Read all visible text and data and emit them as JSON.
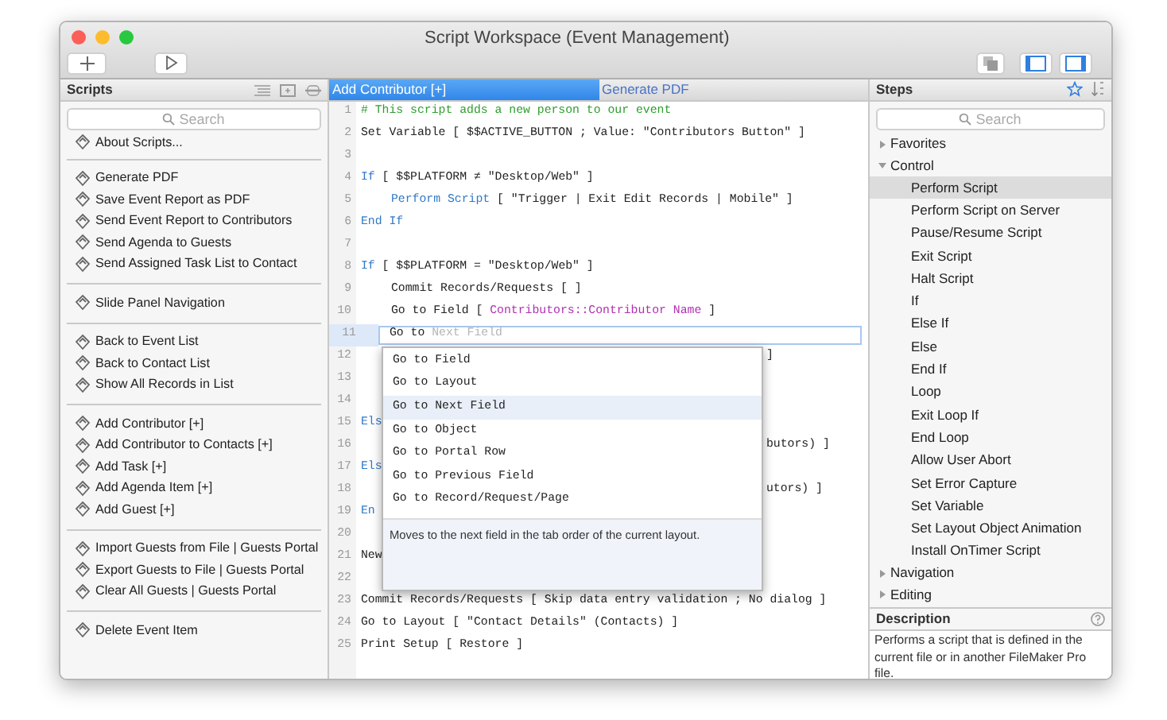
{
  "window": {
    "title": "Script Workspace (Event Management)"
  },
  "toolbar": {
    "toggles": [
      {
        "on": true
      },
      {
        "on": true
      }
    ]
  },
  "scripts": {
    "title": "Scripts",
    "search": {
      "placeholder": "Search"
    },
    "groups": [
      {
        "items": [
          "About Scripts..."
        ]
      },
      {
        "items": [
          "Generate PDF",
          "Save Event Report as PDF",
          "Send Event Report to Contributors",
          "Send Agenda to Guests",
          "Send Assigned Task List to Contact"
        ]
      },
      {
        "items": [
          "Slide Panel Navigation"
        ]
      },
      {
        "items": [
          "Back to Event List",
          "Back to Contact List",
          "Show All Records in List"
        ]
      },
      {
        "items": [
          "Add Contributor [+]",
          "Add Contributor to Contacts [+]",
          "Add Task [+]",
          "Add Agenda Item [+]",
          "Add Guest [+]"
        ]
      },
      {
        "items": [
          "Import Guests from File | Guests Portal",
          "Export Guests to File | Guests Portal",
          "Clear All Guests | Guests Portal"
        ]
      },
      {
        "items": [
          "Delete Event Item"
        ]
      }
    ]
  },
  "editor": {
    "tabs": [
      {
        "label": "Add Contributor [+]",
        "selected": true
      },
      {
        "label": "Generate PDF",
        "selected": false
      }
    ],
    "lines": [
      {
        "number": "1",
        "indented": false,
        "editing": false,
        "segments": [
          {
            "kind": "comment",
            "text": "# This script adds a new person to our event"
          }
        ]
      },
      {
        "number": "2",
        "indented": false,
        "editing": false,
        "segments": [
          {
            "kind": "plain",
            "text": "Set Variable [ $$ACTIVE_BUTTON ; Value: \"Contributors Button\" ]"
          }
        ]
      },
      {
        "number": "3",
        "editing": false
      },
      {
        "number": "4",
        "indented": false,
        "editing": false,
        "segments": [
          {
            "kind": "keyword",
            "text": "If"
          },
          {
            "kind": "plain",
            "text": " [ $$PLATFORM ≠ \"Desktop/Web\" ]"
          }
        ]
      },
      {
        "number": "5",
        "indented": true,
        "editing": false,
        "segments": [
          {
            "kind": "keyword",
            "text": "Perform Script"
          },
          {
            "kind": "plain",
            "text": " [ \"Trigger | Exit Edit Records | Mobile\" ]"
          }
        ]
      },
      {
        "number": "6",
        "indented": false,
        "editing": false,
        "segments": [
          {
            "kind": "keyword",
            "text": "End If"
          }
        ]
      },
      {
        "number": "7",
        "editing": false
      },
      {
        "number": "8",
        "indented": false,
        "editing": false,
        "segments": [
          {
            "kind": "keyword",
            "text": "If"
          },
          {
            "kind": "plain",
            "text": " [ $$PLATFORM = \"Desktop/Web\" ]"
          }
        ]
      },
      {
        "number": "9",
        "indented": true,
        "editing": false,
        "segments": [
          {
            "kind": "plain",
            "text": "Commit Records/Requests [ ]"
          }
        ]
      },
      {
        "number": "10",
        "indented": true,
        "editing": false,
        "segments": [
          {
            "kind": "plain",
            "text": "Go to Field [ "
          },
          {
            "kind": "field",
            "text": "Contributors::Contributor Name"
          },
          {
            "kind": "plain",
            "text": " ]"
          }
        ]
      },
      {
        "number": "11",
        "indented": true,
        "editing": true,
        "segments": [
          {
            "kind": "plain",
            "text": "Go to "
          },
          {
            "kind": "placeholder",
            "text": "Next Field"
          }
        ]
      },
      {
        "number": "12",
        "editing": false,
        "tail": "]"
      },
      {
        "number": "13",
        "editing": false
      },
      {
        "number": "14",
        "editing": false
      },
      {
        "number": "15",
        "indented": false,
        "editing": false,
        "segments": [
          {
            "kind": "keyword",
            "text": "Els"
          }
        ]
      },
      {
        "number": "16",
        "editing": false,
        "tail": "butors) ]"
      },
      {
        "number": "17",
        "indented": false,
        "editing": false,
        "segments": [
          {
            "kind": "keyword",
            "text": "Els"
          }
        ]
      },
      {
        "number": "18",
        "editing": false,
        "tail": "utors) ]"
      },
      {
        "number": "19",
        "indented": false,
        "editing": false,
        "segments": [
          {
            "kind": "keyword",
            "text": "En"
          }
        ]
      },
      {
        "number": "20",
        "editing": false
      },
      {
        "number": "21",
        "indented": false,
        "editing": false,
        "segments": [
          {
            "kind": "plain",
            "text": "New"
          }
        ]
      },
      {
        "number": "22",
        "editing": false
      },
      {
        "number": "23",
        "indented": false,
        "editing": false,
        "segments": [
          {
            "kind": "plain",
            "text": "Commit Records/Requests [ Skip data entry validation ; No dialog ]"
          }
        ]
      },
      {
        "number": "24",
        "indented": false,
        "editing": false,
        "segments": [
          {
            "kind": "plain",
            "text": "Go to Layout [ \"Contact Details\" (Contacts) ]"
          }
        ]
      },
      {
        "number": "25",
        "indented": false,
        "editing": false,
        "segments": [
          {
            "kind": "plain",
            "text": "Print Setup [ Restore ]"
          }
        ]
      }
    ],
    "completion": {
      "items": [
        {
          "text": "Go to Field",
          "selected": false
        },
        {
          "text": "Go to Layout",
          "selected": false
        },
        {
          "text": "Go to Next Field",
          "selected": true
        },
        {
          "text": "Go to Object",
          "selected": false
        },
        {
          "text": "Go to Portal Row",
          "selected": false
        },
        {
          "text": "Go to Previous Field",
          "selected": false
        },
        {
          "text": "Go to Record/Request/Page",
          "selected": false
        }
      ],
      "description": "Moves to the next field in the tab order of the current layout."
    }
  },
  "steps": {
    "title": "Steps",
    "search": {
      "placeholder": "Search"
    },
    "tree": [
      {
        "label": "Favorites",
        "expanded": false
      },
      {
        "label": "Control",
        "expanded": true,
        "children": [
          {
            "label": "Perform Script",
            "selected": true
          },
          {
            "label": "Perform Script on Server",
            "selected": false
          },
          {
            "label": "Pause/Resume Script",
            "selected": false
          },
          {
            "label": "Exit Script",
            "selected": false
          },
          {
            "label": "Halt Script",
            "selected": false
          },
          {
            "label": "If",
            "selected": false
          },
          {
            "label": "Else If",
            "selected": false
          },
          {
            "label": "Else",
            "selected": false
          },
          {
            "label": "End If",
            "selected": false
          },
          {
            "label": "Loop",
            "selected": false
          },
          {
            "label": "Exit Loop If",
            "selected": false
          },
          {
            "label": "End Loop",
            "selected": false
          },
          {
            "label": "Allow User Abort",
            "selected": false
          },
          {
            "label": "Set Error Capture",
            "selected": false
          },
          {
            "label": "Set Variable",
            "selected": false
          },
          {
            "label": "Set Layout Object Animation",
            "selected": false
          },
          {
            "label": "Install OnTimer Script",
            "selected": false
          }
        ]
      },
      {
        "label": "Navigation",
        "expanded": false
      },
      {
        "label": "Editing",
        "expanded": false
      }
    ],
    "description": {
      "title": "Description",
      "text": "Performs a script that is defined in the current file or in another FileMaker Pro file."
    }
  }
}
